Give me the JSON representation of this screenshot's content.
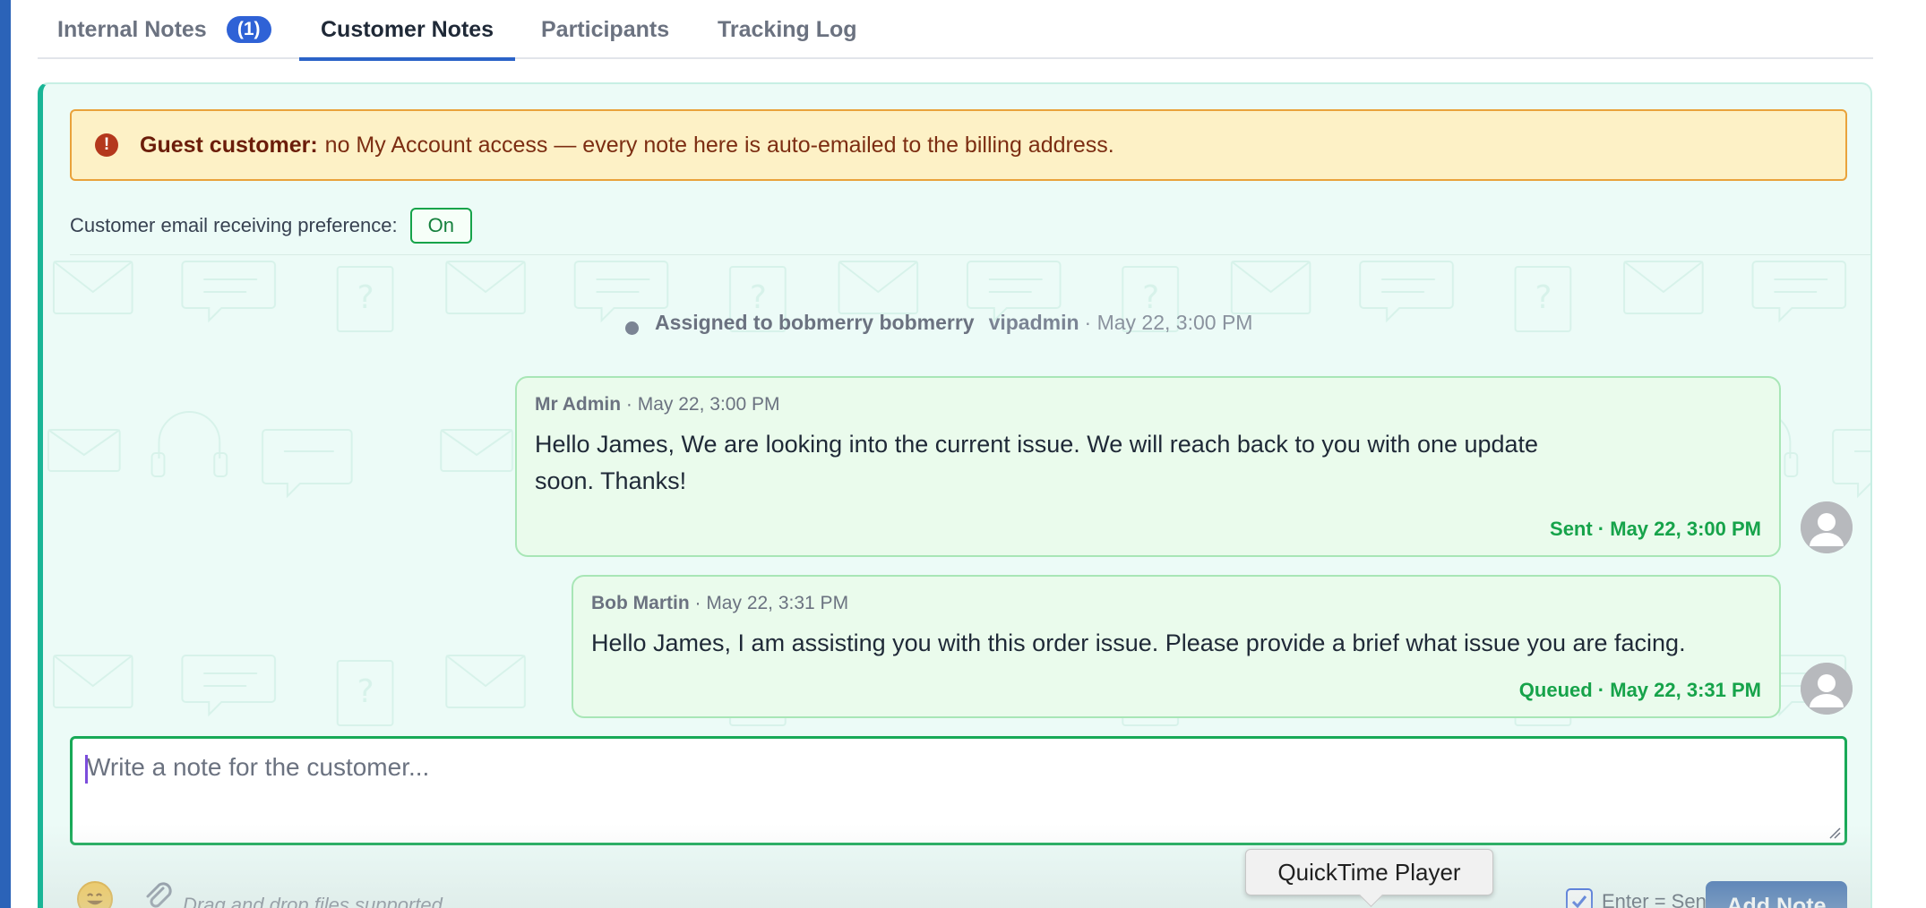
{
  "tabs": [
    {
      "label": "Internal Notes",
      "badge": "(1)",
      "active": false
    },
    {
      "label": "Customer Notes",
      "active": true
    },
    {
      "label": "Participants",
      "active": false
    },
    {
      "label": "Tracking Log",
      "active": false
    }
  ],
  "banner": {
    "icon": "exclamation-circle-icon",
    "title": "Guest customer:",
    "text": "no My Account access — every note here is auto-emailed to the billing address."
  },
  "preference": {
    "label": "Customer email receiving preference:",
    "value": "On"
  },
  "timeline": {
    "event": {
      "text": "Assigned to bobmerry bobmerry",
      "actor": "vipadmin",
      "time": "· May 22, 3:00 PM"
    },
    "messages": [
      {
        "author": "Mr Admin",
        "time": " · May 22, 3:00 PM",
        "body_line1": "Hello James, We are looking into the current issue. We will reach back to you with one update",
        "body_line2": "soon. Thanks!",
        "status": "Sent · May 22, 3:00 PM"
      },
      {
        "author": "Bob Martin",
        "time": " · May 22, 3:31 PM",
        "body_line1": "Hello James, I am assisting you with this order issue. Please provide a brief what issue you are facing.",
        "status": "Queued · May 22, 3:31 PM"
      }
    ]
  },
  "composer": {
    "placeholder": "Write a note for the customer...",
    "drop_hint": "Drag and drop files supported",
    "enter_send_label": "Enter = Send",
    "enter_send_checked": true,
    "submit_label": "Add Note"
  },
  "tooltip": {
    "text": "QuickTime Player"
  },
  "colors": {
    "accent": "#2b63c8",
    "panel_bg": "#ecfbf7",
    "panel_border_left": "#19b596",
    "banner_bg": "#fdf1c6",
    "status_green": "#16a34a",
    "submit_bg": "#2b5fa8"
  }
}
